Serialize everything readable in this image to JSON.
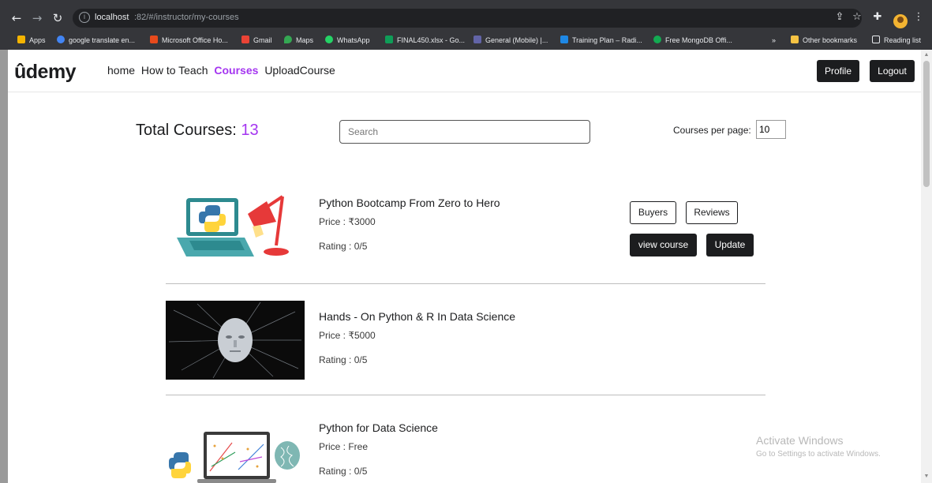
{
  "browser": {
    "url_host": "localhost",
    "url_path": ":82/#/instructor/my-courses",
    "bookmarks": [
      {
        "label": "Apps",
        "color": "#f4b400"
      },
      {
        "label": "google translate en...",
        "color": "#4285f4"
      },
      {
        "label": "Microsoft Office Ho...",
        "color": "#e84a1c"
      },
      {
        "label": "Gmail",
        "color": "#ea4335"
      },
      {
        "label": "Maps",
        "color": "#34a853"
      },
      {
        "label": "WhatsApp",
        "color": "#25d366"
      },
      {
        "label": "FINAL450.xlsx - Go...",
        "color": "#0f9d58"
      },
      {
        "label": "General (Mobile) |...",
        "color": "#6264a7"
      },
      {
        "label": "Training Plan – Radi...",
        "color": "#1e88e5"
      },
      {
        "label": "Free MongoDB Offi...",
        "color": "#13aa52"
      }
    ],
    "overflow": "»",
    "other_bookmarks": "Other bookmarks",
    "reading_list": "Reading list"
  },
  "nav": {
    "logo": "ûdemy",
    "links": [
      "home",
      "How to Teach",
      "Courses",
      "UploadCourse"
    ],
    "active": "Courses",
    "profile_label": "Profile",
    "logout_label": "Logout"
  },
  "toolbar": {
    "total_label": "Total Courses:",
    "total_count": "13",
    "search_placeholder": "Search",
    "per_page_label": "Courses per page:",
    "per_page_value": "10"
  },
  "courses": [
    {
      "title": "Python Bootcamp From Zero to Hero",
      "price": "Price : ₹3000",
      "rating": "Rating : 0/5",
      "image": "python-lamp-laptop-illustration"
    },
    {
      "title": "Hands - On Python & R In Data Science",
      "price": "Price : ₹5000",
      "rating": "Rating : 0/5",
      "image": "ai-face-particles"
    },
    {
      "title": "Python for Data Science",
      "price": "Price : Free",
      "rating": "Rating : 0/5",
      "image": "python-brain-laptop-illustration"
    }
  ],
  "actions": {
    "buyers": "Buyers",
    "reviews": "Reviews",
    "view_course": "view course",
    "update": "Update"
  },
  "watermark": {
    "line1": "Activate Windows",
    "line2": "Go to Settings to activate Windows."
  },
  "colors": {
    "accent": "#a435f0",
    "dark": "#1c1d1f"
  }
}
